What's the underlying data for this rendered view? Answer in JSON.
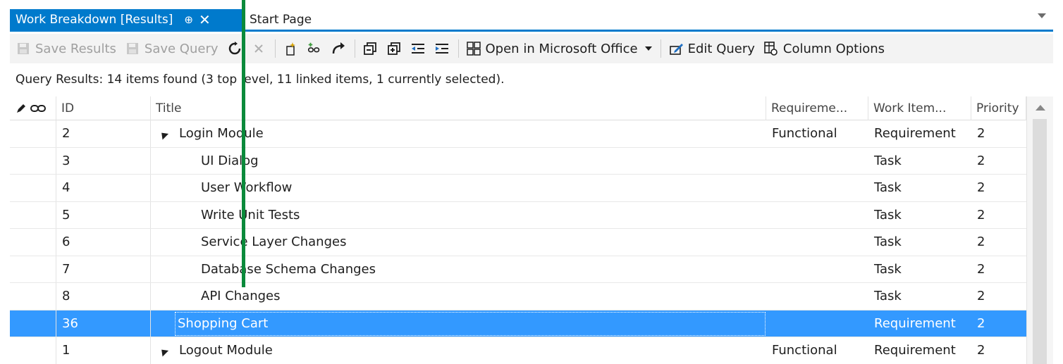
{
  "tabs": {
    "active_label": "Work Breakdown [Results]",
    "pin_glyph": "⊕",
    "close_glyph": "✕",
    "inactive_label": "Start Page"
  },
  "toolbar": {
    "save_results": "Save Results",
    "save_query": "Save Query",
    "open_office": "Open in Microsoft Office",
    "edit_query": "Edit Query",
    "column_options": "Column Options"
  },
  "status": "Query Results: 14 items found (3 top level, 11 linked items, 1 currently selected).",
  "columns": {
    "id": "ID",
    "title": "Title",
    "requirement": "Requireme...",
    "work_item": "Work Item...",
    "priority": "Priority"
  },
  "rows": [
    {
      "id": "2",
      "title": "Login Module",
      "requirement": "Functional",
      "work_item": "Requirement",
      "priority": "2"
    },
    {
      "id": "3",
      "title": "UI Dialog",
      "requirement": "",
      "work_item": "Task",
      "priority": "2"
    },
    {
      "id": "4",
      "title": "User Workflow",
      "requirement": "",
      "work_item": "Task",
      "priority": "2"
    },
    {
      "id": "5",
      "title": "Write Unit Tests",
      "requirement": "",
      "work_item": "Task",
      "priority": "2"
    },
    {
      "id": "6",
      "title": "Service Layer Changes",
      "requirement": "",
      "work_item": "Task",
      "priority": "2"
    },
    {
      "id": "7",
      "title": "Database Schema Changes",
      "requirement": "",
      "work_item": "Task",
      "priority": "2"
    },
    {
      "id": "8",
      "title": "API Changes",
      "requirement": "",
      "work_item": "Task",
      "priority": "2"
    },
    {
      "id": "36",
      "title": "Shopping Cart",
      "requirement": "",
      "work_item": "Requirement",
      "priority": "2"
    },
    {
      "id": "1",
      "title": "Logout Module",
      "requirement": "Functional",
      "work_item": "Requirement",
      "priority": "2"
    }
  ],
  "colors": {
    "accent": "#007acc",
    "selection": "#3399ff",
    "overlay_line": "#0b8a3b"
  }
}
